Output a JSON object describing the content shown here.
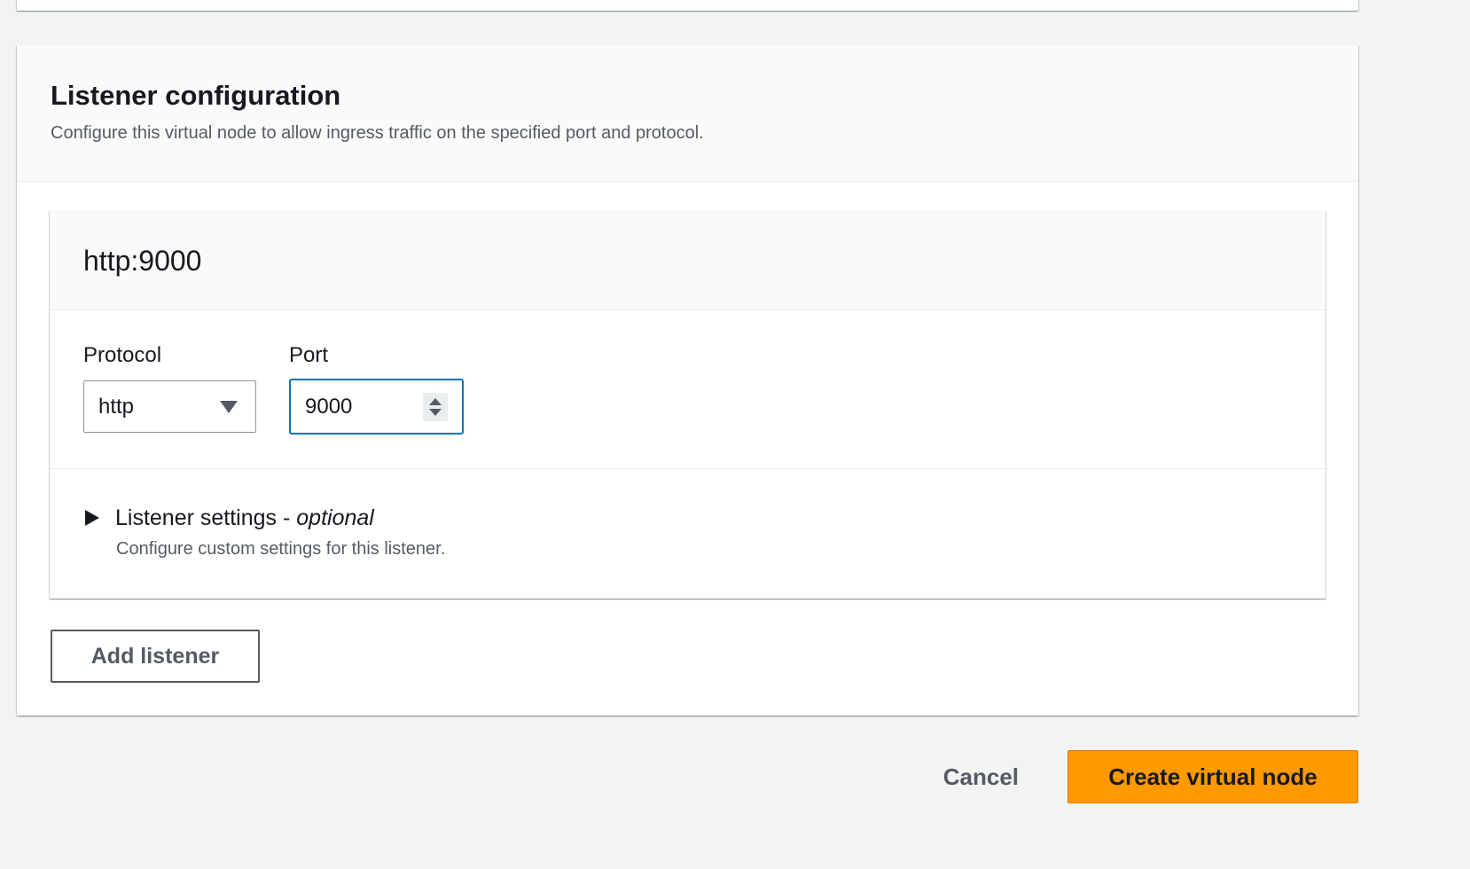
{
  "listener_section": {
    "title": "Listener configuration",
    "description": "Configure this virtual node to allow ingress traffic on the specified port and protocol."
  },
  "listener": {
    "title": "http:9000",
    "protocol": {
      "label": "Protocol",
      "value": "http"
    },
    "port": {
      "label": "Port",
      "value": "9000"
    },
    "settings": {
      "title": "Listener settings - ",
      "optional": "optional",
      "description": "Configure custom settings for this listener."
    }
  },
  "buttons": {
    "add_listener": "Add listener",
    "cancel": "Cancel",
    "create": "Create virtual node"
  },
  "colors": {
    "primary_button": "#ff9900",
    "focus_border": "#0073bb",
    "page_background": "#f2f3f3"
  }
}
